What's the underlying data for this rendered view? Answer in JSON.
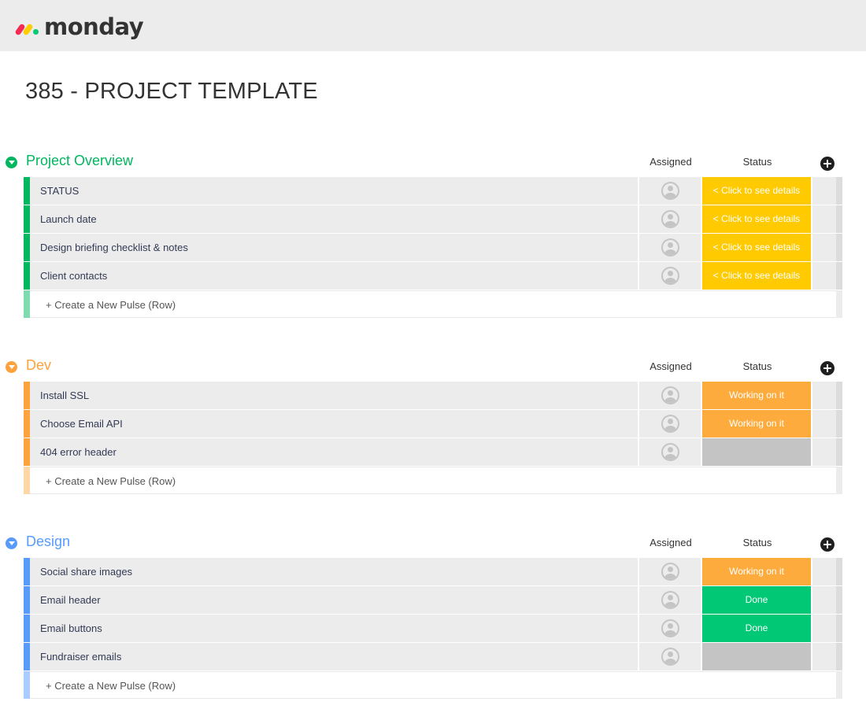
{
  "app": {
    "logo_text": "monday"
  },
  "board": {
    "title": "385 - PROJECT TEMPLATE"
  },
  "columns": {
    "assigned": "Assigned",
    "status": "Status"
  },
  "colors": {
    "status_yellow": "#ffcb00",
    "status_orange": "#fdab3d",
    "status_green": "#00c875",
    "status_empty": "#c4c4c4"
  },
  "new_row_label": "+ Create a New Pulse (Row)",
  "groups": [
    {
      "title": "Project Overview",
      "color": "#00b65f",
      "light_color": "#7fdbb0",
      "rows": [
        {
          "name": "STATUS",
          "status": "< Click to see details",
          "status_color": "#ffcb00"
        },
        {
          "name": "Launch date",
          "status": "< Click to see details",
          "status_color": "#ffcb00"
        },
        {
          "name": "Design briefing checklist & notes",
          "status": "< Click to see details",
          "status_color": "#ffcb00"
        },
        {
          "name": "Client contacts",
          "status": "< Click to see details",
          "status_color": "#ffcb00"
        }
      ]
    },
    {
      "title": "Dev",
      "color": "#fda23c",
      "light_color": "#fed6a8",
      "rows": [
        {
          "name": "Install SSL",
          "status": "Working on it",
          "status_color": "#fdab3d"
        },
        {
          "name": "Choose Email API",
          "status": "Working on it",
          "status_color": "#fdab3d"
        },
        {
          "name": "404 error header",
          "status": "",
          "status_color": "#c4c4c4"
        }
      ]
    },
    {
      "title": "Design",
      "color": "#579bfc",
      "light_color": "#abcdfd",
      "rows": [
        {
          "name": "Social share images",
          "status": "Working on it",
          "status_color": "#fdab3d"
        },
        {
          "name": "Email header",
          "status": "Done",
          "status_color": "#00c875"
        },
        {
          "name": "Email buttons",
          "status": "Done",
          "status_color": "#00c875"
        },
        {
          "name": "Fundraiser emails",
          "status": "",
          "status_color": "#c4c4c4"
        }
      ]
    }
  ]
}
